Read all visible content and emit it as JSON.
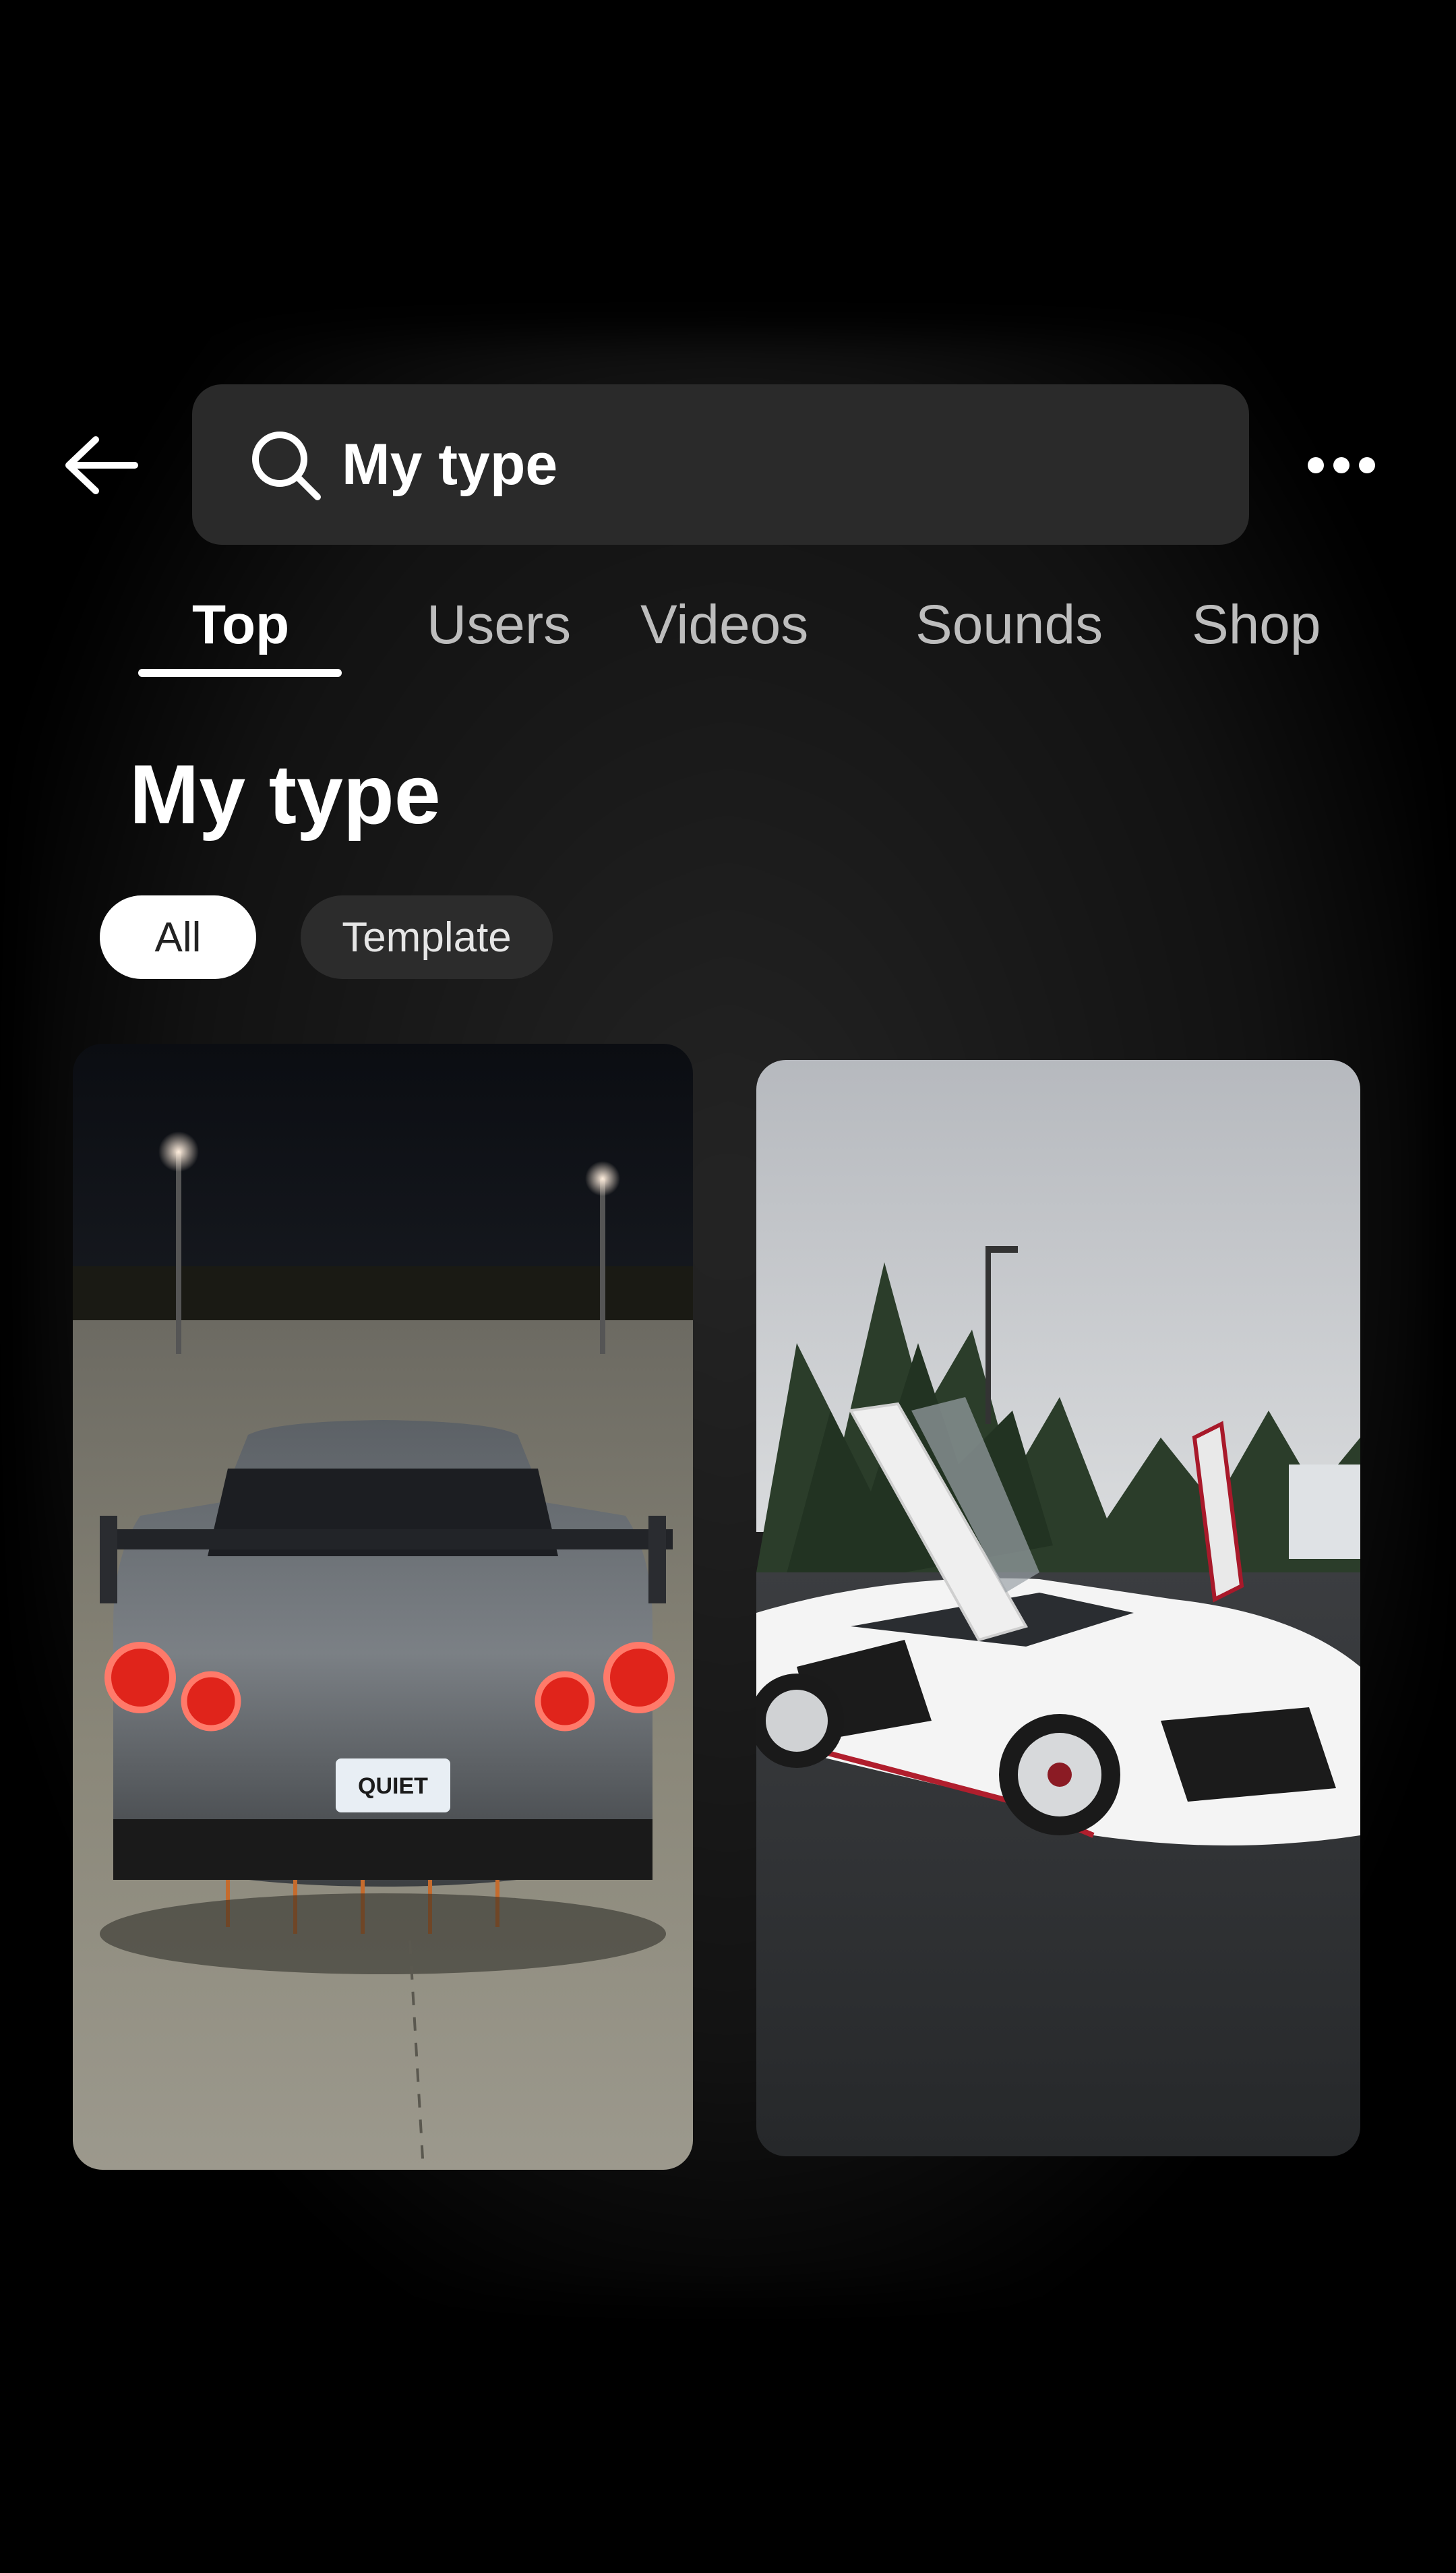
{
  "search": {
    "query": "My type",
    "placeholder": "Search"
  },
  "tabs": [
    {
      "label": "Top",
      "active": true
    },
    {
      "label": "Users",
      "active": false
    },
    {
      "label": "Videos",
      "active": false
    },
    {
      "label": "Sounds",
      "active": false
    },
    {
      "label": "Shop",
      "active": false
    }
  ],
  "section": {
    "title": "My type"
  },
  "filters": [
    {
      "label": "All",
      "selected": true
    },
    {
      "label": "Template",
      "selected": false
    }
  ],
  "results": [
    {
      "kind": "video-thumbnail",
      "plate_text": "QUIET"
    },
    {
      "kind": "video-thumbnail"
    }
  ],
  "colors": {
    "background": "#000000",
    "search_bg": "#2a2a2a",
    "chip_selected_bg": "#ffffff",
    "chip_bg": "#2c2c2c",
    "tab_inactive": "#bdbdbd",
    "tail_light": "#e0241b"
  },
  "icons": {
    "back": "arrow-left-icon",
    "search": "search-icon",
    "more": "more-horizontal-icon"
  }
}
